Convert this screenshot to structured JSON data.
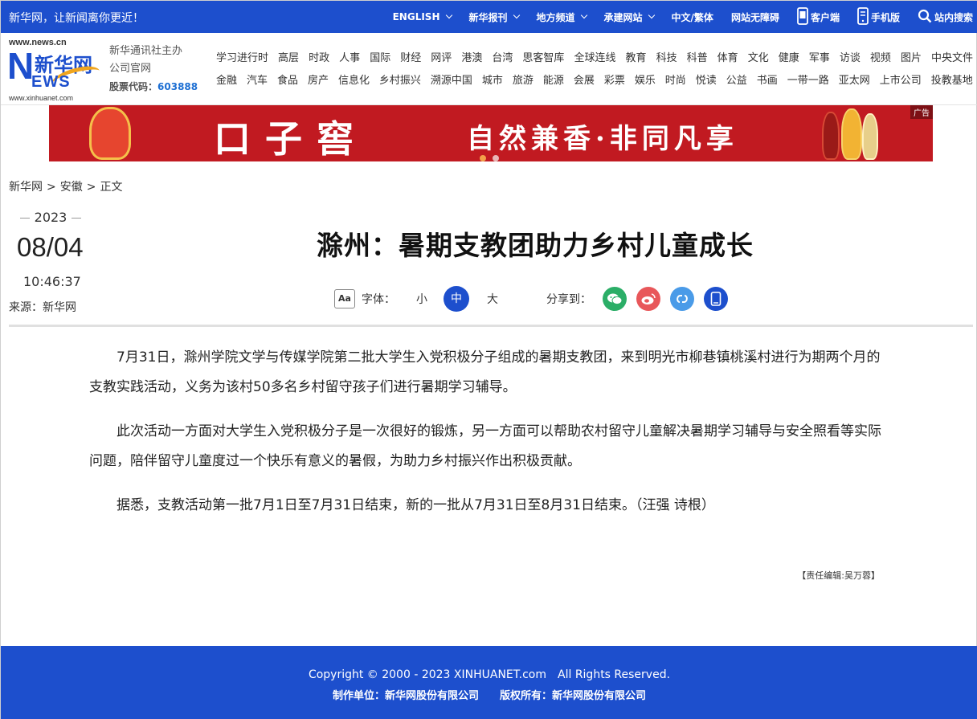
{
  "topbar": {
    "slogan": "新华网，让新闻离你更近！",
    "nav": [
      {
        "label": "ENGLISH",
        "dropdown": true,
        "icon": ""
      },
      {
        "label": "新华报刊",
        "dropdown": true,
        "icon": ""
      },
      {
        "label": "地方频道",
        "dropdown": true,
        "icon": ""
      },
      {
        "label": "承建网站",
        "dropdown": true,
        "icon": ""
      },
      {
        "label": "中文/繁体",
        "dropdown": false,
        "icon": ""
      },
      {
        "label": "网站无障碍",
        "dropdown": false,
        "icon": ""
      },
      {
        "label": "客户端",
        "dropdown": false,
        "icon": "app-phone-icon"
      },
      {
        "label": "手机版",
        "dropdown": false,
        "icon": "mobile-icon"
      },
      {
        "label": "站内搜索",
        "dropdown": false,
        "icon": "search-icon"
      }
    ]
  },
  "logo": {
    "url_top": "www.news.cn",
    "n": "N",
    "cn": "新华网",
    "ews": "EWS",
    "url_bottom": "www.xinhuanet.com"
  },
  "org": {
    "line1": "新华通讯社主办",
    "line2": "公司官网",
    "stock_label": "股票代码：",
    "stock_code": "603888"
  },
  "channels": {
    "row1": [
      "学习进行时",
      "高层",
      "时政",
      "人事",
      "国际",
      "财经",
      "网评",
      "港澳",
      "台湾",
      "思客智库",
      "全球连线",
      "教育",
      "科技",
      "科普",
      "体育",
      "文化",
      "健康",
      "军事",
      "访谈",
      "视频",
      "图片",
      "中央文件"
    ],
    "row2": [
      "金融",
      "汽车",
      "食品",
      "房产",
      "信息化",
      "乡村振兴",
      "溯源中国",
      "城市",
      "旅游",
      "能源",
      "会展",
      "彩票",
      "娱乐",
      "时尚",
      "悦读",
      "公益",
      "书画",
      "一带一路",
      "亚太网",
      "上市公司",
      "投教基地"
    ]
  },
  "ad": {
    "label": "广告",
    "brand": "口子窖",
    "tagline": "自然兼香·非同凡享",
    "colors": {
      "bg": "#c11a21",
      "dot": "#f3a04a"
    }
  },
  "breadcrumb": [
    "新华网",
    "安徽",
    "正文"
  ],
  "breadcrumb_sep": ">",
  "date": {
    "year": "2023",
    "month_day": "08/04",
    "time": "10:46:37",
    "source": "来源：新华网"
  },
  "article": {
    "title": "滁州：暑期支教团助力乡村儿童成长",
    "font_label": "字体：",
    "font_sizes": [
      "小",
      "中",
      "大"
    ],
    "font_selected": "中",
    "share_label": "分享到：",
    "share": [
      {
        "name": "wechat-icon",
        "color": "#2bae67"
      },
      {
        "name": "weibo-icon",
        "color": "#e8575a"
      },
      {
        "name": "link-icon",
        "color": "#4a9be8"
      },
      {
        "name": "mobile-share-icon",
        "color": "#1d4fcd"
      }
    ],
    "paragraphs": [
      "7月31日，滁州学院文学与传媒学院第二批大学生入党积极分子组成的暑期支教团，来到明光市柳巷镇桃溪村进行为期两个月的支教实践活动，义务为该村50多名乡村留守孩子们进行暑期学习辅导。",
      "此次活动一方面对大学生入党积极分子是一次很好的锻炼，另一方面可以帮助农村留守儿童解决暑期学习辅导与安全照看等实际问题，陪伴留守儿童度过一个快乐有意义的暑假，为助力乡村振兴作出积极贡献。",
      "据悉，支教活动第一批7月1日至7月31日结束，新的一批从7月31日至8月31日结束。（汪强 诗根）"
    ],
    "editor": "【责任编辑:吴万蓉】"
  },
  "footer": {
    "copyright": "Copyright © 2000 - 2023 XINHUANET.com　All Rights Reserved.",
    "producer": "制作单位：新华网股份有限公司",
    "owner": "版权所有：新华网股份有限公司",
    "bg": "#1d4fcd"
  }
}
